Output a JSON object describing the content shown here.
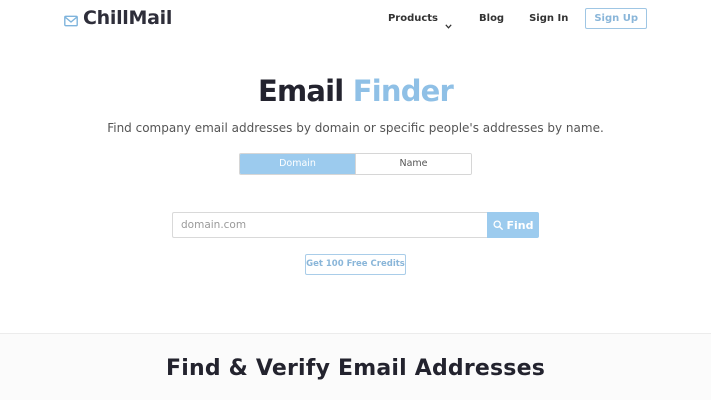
{
  "header": {
    "brand_name": "ChillMail",
    "brand_icon": "envelope-icon",
    "nav": {
      "products_label": "Products",
      "blog_label": "Blog",
      "signin_label": "Sign In",
      "signup_label": "Sign Up"
    }
  },
  "hero": {
    "title_part1": "Email",
    "title_part2": "Finder",
    "subtitle": "Find company email addresses by domain or specific people's addresses by name.",
    "toggle": {
      "domain_label": "Domain",
      "name_label": "Name",
      "selected": "Domain"
    },
    "search": {
      "placeholder": "domain.com",
      "value": "",
      "find_label": "Find"
    },
    "credits_label": "Get 100 Free Credits"
  },
  "section": {
    "title": "Find & Verify Email Addresses"
  },
  "colors": {
    "accent": "#9ccbee",
    "accent_text": "#8ab6d9",
    "dark": "#23232e"
  }
}
